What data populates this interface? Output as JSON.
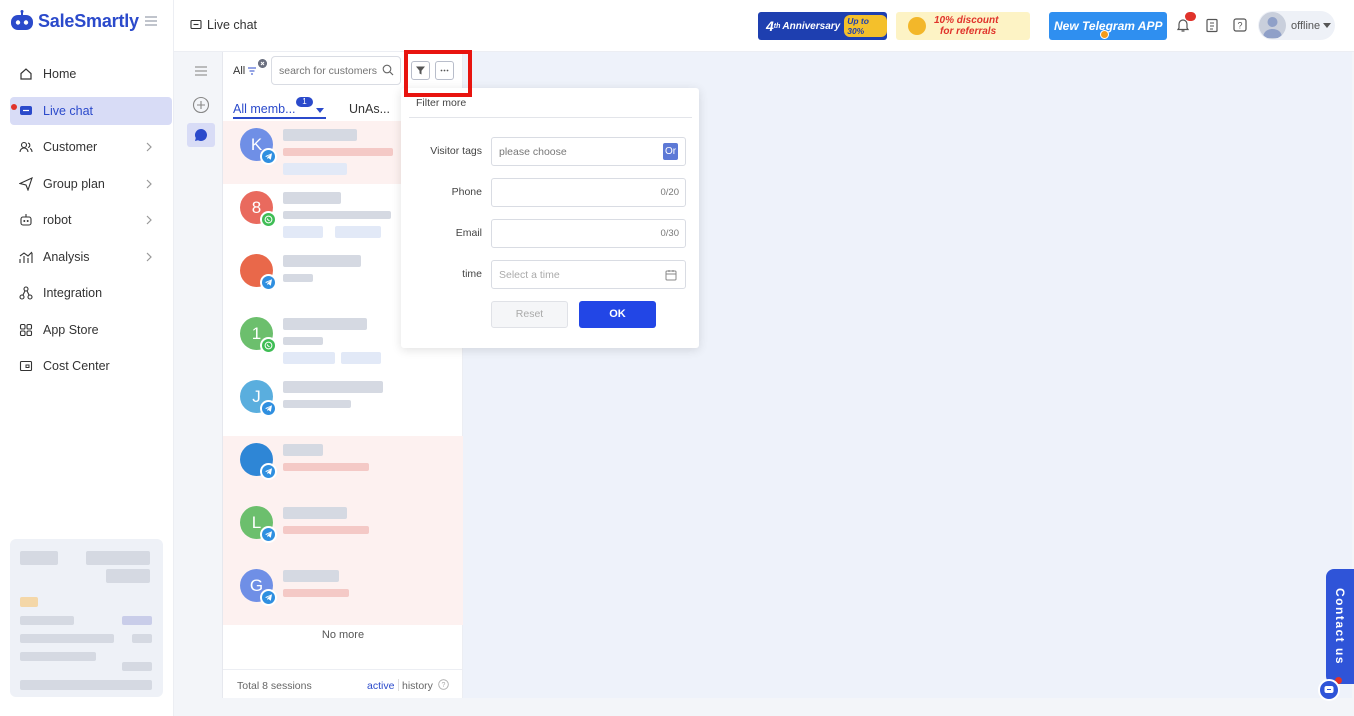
{
  "brand": {
    "name": "SaleSmartly"
  },
  "sidebar": {
    "items": [
      {
        "label": "Home",
        "icon": "home-icon",
        "has_chevron": false
      },
      {
        "label": "Live chat",
        "icon": "live-chat-icon",
        "has_chevron": false,
        "active": true
      },
      {
        "label": "Customer",
        "icon": "customer-icon",
        "has_chevron": true
      },
      {
        "label": "Group plan",
        "icon": "send-icon",
        "has_chevron": true
      },
      {
        "label": "robot",
        "icon": "robot-icon",
        "has_chevron": true
      },
      {
        "label": "Analysis",
        "icon": "analysis-icon",
        "has_chevron": true
      },
      {
        "label": "Integration",
        "icon": "integration-icon",
        "has_chevron": false
      },
      {
        "label": "App Store",
        "icon": "app-store-icon",
        "has_chevron": false
      },
      {
        "label": "Cost Center",
        "icon": "wallet-icon",
        "has_chevron": false
      }
    ]
  },
  "topbar": {
    "page_title": "Live chat",
    "banners": {
      "anniversary_num": "4",
      "anniversary_sup": "th",
      "anniversary_label": "Anniversary",
      "anniversary_offer": "Up to 30%",
      "discount_line1": "10% discount",
      "discount_line2": "for referrals",
      "telegram": "New Telegram APP"
    },
    "user_status": "offline"
  },
  "session_list": {
    "filter_label": "All",
    "search_placeholder": "search for customers",
    "tabs": [
      {
        "label": "All memb...",
        "count": "1"
      },
      {
        "label": "UnAs..."
      }
    ],
    "no_more": "No more",
    "total": "Total 8 sessions",
    "active_label": "active",
    "history_label": "history",
    "sessions": [
      {
        "initial": "K",
        "avatar_color": "#6f8fe6",
        "channel": "telegram",
        "unread": true
      },
      {
        "initial": "8",
        "avatar_color": "#e96a5e",
        "channel": "whatsapp",
        "unread": false
      },
      {
        "initial": "",
        "avatar_color": "#e9684a",
        "channel": "telegram",
        "unread": false
      },
      {
        "initial": "1",
        "avatar_color": "#6cbf6d",
        "channel": "whatsapp",
        "unread": false
      },
      {
        "initial": "J",
        "avatar_color": "#5aaede",
        "channel": "telegram",
        "unread": false
      },
      {
        "initial": "",
        "avatar_color": "#2e86d6",
        "channel": "telegram",
        "unread": true
      },
      {
        "initial": "L",
        "avatar_color": "#6cbf6d",
        "channel": "telegram",
        "unread": true
      },
      {
        "initial": "G",
        "avatar_color": "#6f8fe6",
        "channel": "telegram",
        "unread": true
      }
    ]
  },
  "filter_popup": {
    "title": "Filter more",
    "fields": [
      {
        "label": "Visitor tags",
        "placeholder": "please choose",
        "suffix": "Or",
        "kind": "select"
      },
      {
        "label": "Phone",
        "placeholder": "",
        "count": "0/20",
        "kind": "text"
      },
      {
        "label": "Email",
        "placeholder": "",
        "count": "0/30",
        "kind": "text"
      },
      {
        "label": "time",
        "placeholder": "Select a time",
        "kind": "date"
      }
    ],
    "reset_label": "Reset",
    "ok_label": "OK"
  },
  "contact_us": "Contact us",
  "colors": {
    "brand": "#2b4acb",
    "primary_button": "#2246e6",
    "highlight_frame": "#e8140f",
    "unread_bg": "#fdf1f0"
  }
}
